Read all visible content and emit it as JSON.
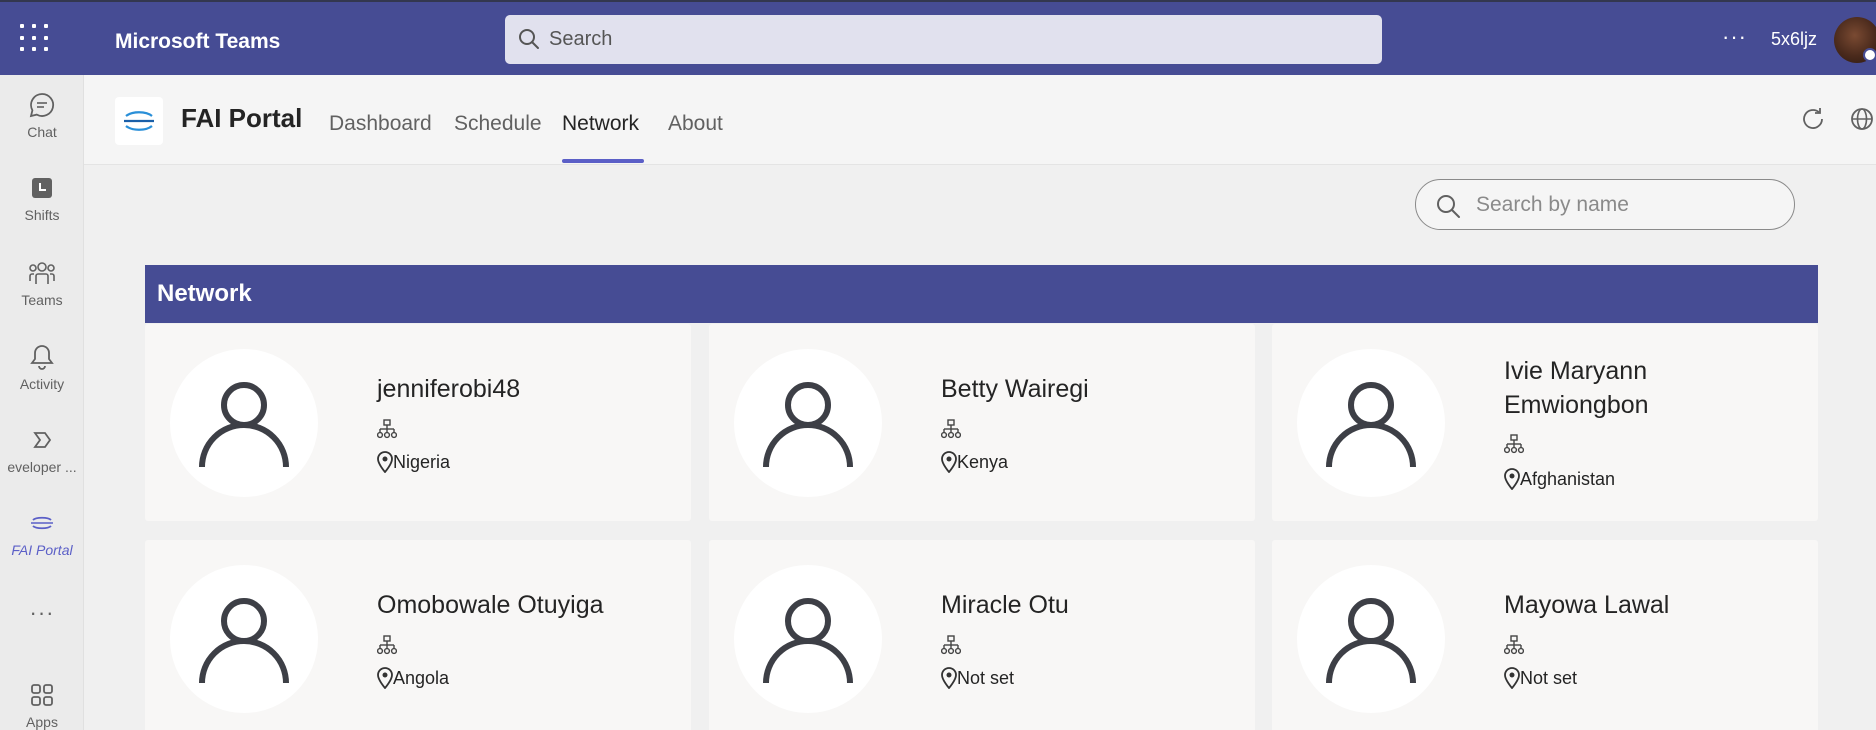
{
  "topbar": {
    "app_name": "Microsoft Teams",
    "search_placeholder": "Search",
    "more": "···",
    "user": "5x6ljz"
  },
  "rail": {
    "items": [
      {
        "label": "Chat",
        "icon": "chat-icon"
      },
      {
        "label": "Shifts",
        "icon": "shifts-icon"
      },
      {
        "label": "Teams",
        "icon": "teams-icon"
      },
      {
        "label": "Activity",
        "icon": "bell-icon"
      },
      {
        "label": "eveloper ...",
        "icon": "developer-portal-icon"
      },
      {
        "label": "FAI Portal",
        "icon": "fai-portal-icon"
      },
      {
        "label": "",
        "icon": "more-apps-icon"
      },
      {
        "label": "Apps",
        "icon": "apps-icon"
      }
    ]
  },
  "app": {
    "title": "FAI Portal",
    "tabs": [
      "Dashboard",
      "Schedule",
      "Network",
      "About"
    ],
    "active_tab": "Network"
  },
  "main": {
    "search_placeholder": "Search by name",
    "section_title": "Network",
    "people": [
      {
        "name": "jenniferobi48",
        "location": "Nigeria"
      },
      {
        "name": "Betty Wairegi",
        "location": "Kenya"
      },
      {
        "name": "Ivie Maryann Emwiongbon",
        "location": "Afghanistan"
      },
      {
        "name": "Omobowale Otuyiga",
        "location": "Angola"
      },
      {
        "name": "Miracle Otu",
        "location": "Not set"
      },
      {
        "name": "Mayowa Lawal",
        "location": "Not set"
      }
    ]
  },
  "colors": {
    "brand": "#464c94",
    "accent": "#5b5fc7"
  }
}
